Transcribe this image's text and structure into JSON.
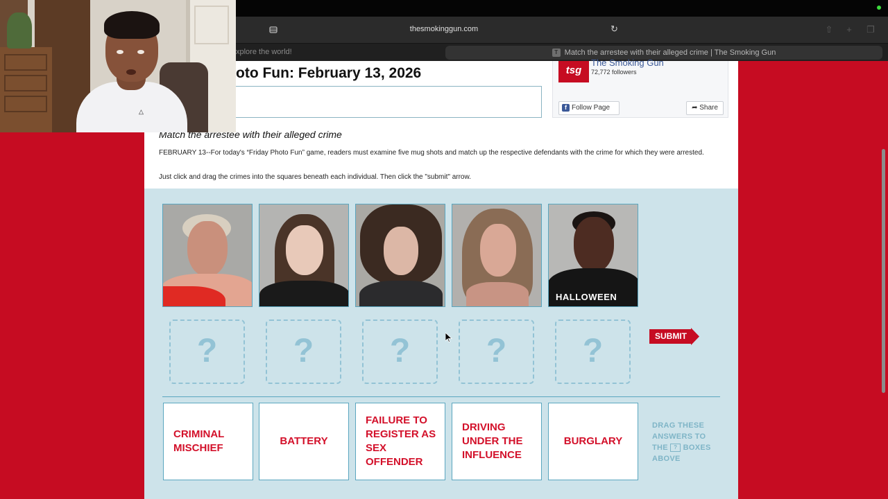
{
  "browser": {
    "url": "thesmokinggun.com",
    "tab_left_partial": "xplore the world!",
    "active_tab_favicon": "T",
    "active_tab_title": "Match the arrestee with their alleged crime | The Smoking Gun"
  },
  "article": {
    "title_partial": "oto Fun: February 13, 2026",
    "subtitle": "Match the arrestee with their alleged crime",
    "intro": "FEBRUARY 13--For today's “Friday Photo Fun” game, readers must examine five mug shots and match up the respective defendants with the crime for which they were arrested.",
    "instructions": "Just click and drag the crimes into the squares beneath each individual. Then click the \"submit\" arrow."
  },
  "facebook": {
    "logo_text": "tsg",
    "page_name": "The Smoking Gun",
    "followers": "72,772 followers",
    "follow_label": "Follow Page",
    "follow_icon": "f",
    "share_label": "Share"
  },
  "game": {
    "mugshots": [
      {
        "name": "mugshot-1"
      },
      {
        "name": "mugshot-2"
      },
      {
        "name": "mugshot-3"
      },
      {
        "name": "mugshot-4"
      },
      {
        "name": "mugshot-5",
        "shirt_text": "HALLOWEEN"
      }
    ],
    "drop_placeholder": "?",
    "submit_label": "SUBMIT",
    "answers": [
      "CRIMINAL MISCHIEF",
      "BATTERY",
      "FAILURE TO REGISTER AS SEX OFFENDER",
      "DRIVING UNDER THE INFLUENCE",
      "BURGLARY"
    ],
    "drag_help_1": "DRAG THESE ANSWERS TO THE",
    "drag_help_icon": "?",
    "drag_help_2": "BOXES ABOVE"
  },
  "colors": {
    "site_red": "#c60c22",
    "game_bg": "#cde3ea",
    "answer_text": "#d3102a",
    "facebook_blue": "#3b5998"
  },
  "icons": [
    "sidebar-icon",
    "reload-icon",
    "share-icon",
    "new-tab-icon",
    "tabs-overview-icon",
    "facebook-icon",
    "share-arrow-icon",
    "cursor-icon"
  ]
}
